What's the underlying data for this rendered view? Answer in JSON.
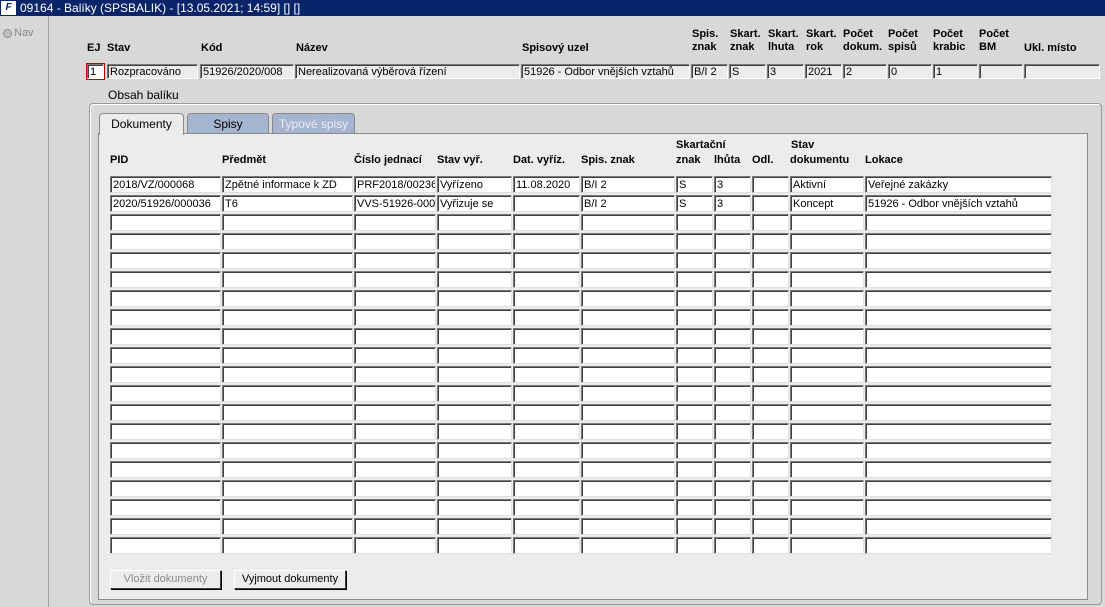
{
  "window": {
    "title": "09164 - Balíky (SPSBALIK) - [13.05.2021; 14:59] [] []",
    "app_icon": "oracle-forms-icon"
  },
  "nav": {
    "label": "Nav"
  },
  "header": {
    "columns": {
      "ej": "EJ",
      "stav": "Stav",
      "kod": "Kód",
      "nazev": "Název",
      "spisovy_uzel": "Spisový uzel",
      "spis_znak": [
        "Spis.",
        "znak"
      ],
      "skart_znak": [
        "Skart.",
        "znak"
      ],
      "skart_lhuta": [
        "Skart.",
        "lhuta"
      ],
      "skart_rok": [
        "Skart.",
        "rok"
      ],
      "pocet_dokum": [
        "Počet",
        "dokum."
      ],
      "pocet_spisu": [
        "Počet",
        "spisů"
      ],
      "pocet_krabic": [
        "Počet",
        "krabic"
      ],
      "pocet_bm": [
        "Počet",
        "BM"
      ],
      "ukl_misto": "Ukl. místo"
    },
    "values": {
      "ej": "1",
      "stav": "Rozpracováno",
      "kod": "51926/2020/008",
      "nazev": "Nerealizovaná výběrová řízení",
      "spisovy_uzel": "51926 - Odbor vnějších vztahů",
      "spis_znak": "B/I 2",
      "skart_znak": "S",
      "skart_lhuta": "3",
      "skart_rok": "2021",
      "pocet_dokum": "2",
      "pocet_spisu": "0",
      "pocet_krabic": "1",
      "pocet_bm": "",
      "ukl_misto": ""
    }
  },
  "content": {
    "group_title": "Obsah balíku",
    "tabs": [
      {
        "label": "Dokumenty",
        "state": "active"
      },
      {
        "label": "Spisy",
        "state": "enabled"
      },
      {
        "label": "Typové spisy",
        "state": "disabled"
      }
    ],
    "table": {
      "group_header": {
        "skartacni": "Skartační",
        "stav": "Stav"
      },
      "columns": [
        "PID",
        "Předmět",
        "Číslo jednací",
        "Stav vyř.",
        "Dat. vyříz.",
        "Spis. znak",
        "znak",
        "lhůta",
        "Odl.",
        "dokumentu",
        "Lokace"
      ],
      "rows": [
        [
          "2018/VZ/000068",
          "Zpětné informace k ZD",
          "PRF2018/00236",
          "Vyřízeno",
          "11.08.2020",
          "B/I 2",
          "S",
          "3",
          "",
          "Aktivní",
          "Veřejné zakázky"
        ],
        [
          "2020/51926/000036",
          "T6",
          "VVS-51926-000",
          "Vyřizuje se",
          "",
          "B/I 2",
          "S",
          "3",
          "",
          "Koncept",
          "51926 - Odbor vnějších vztahů"
        ]
      ],
      "empty_rows": 18
    },
    "buttons": {
      "insert": "Vložit dokumenty",
      "remove": "Vyjmout dokumenty"
    }
  }
}
